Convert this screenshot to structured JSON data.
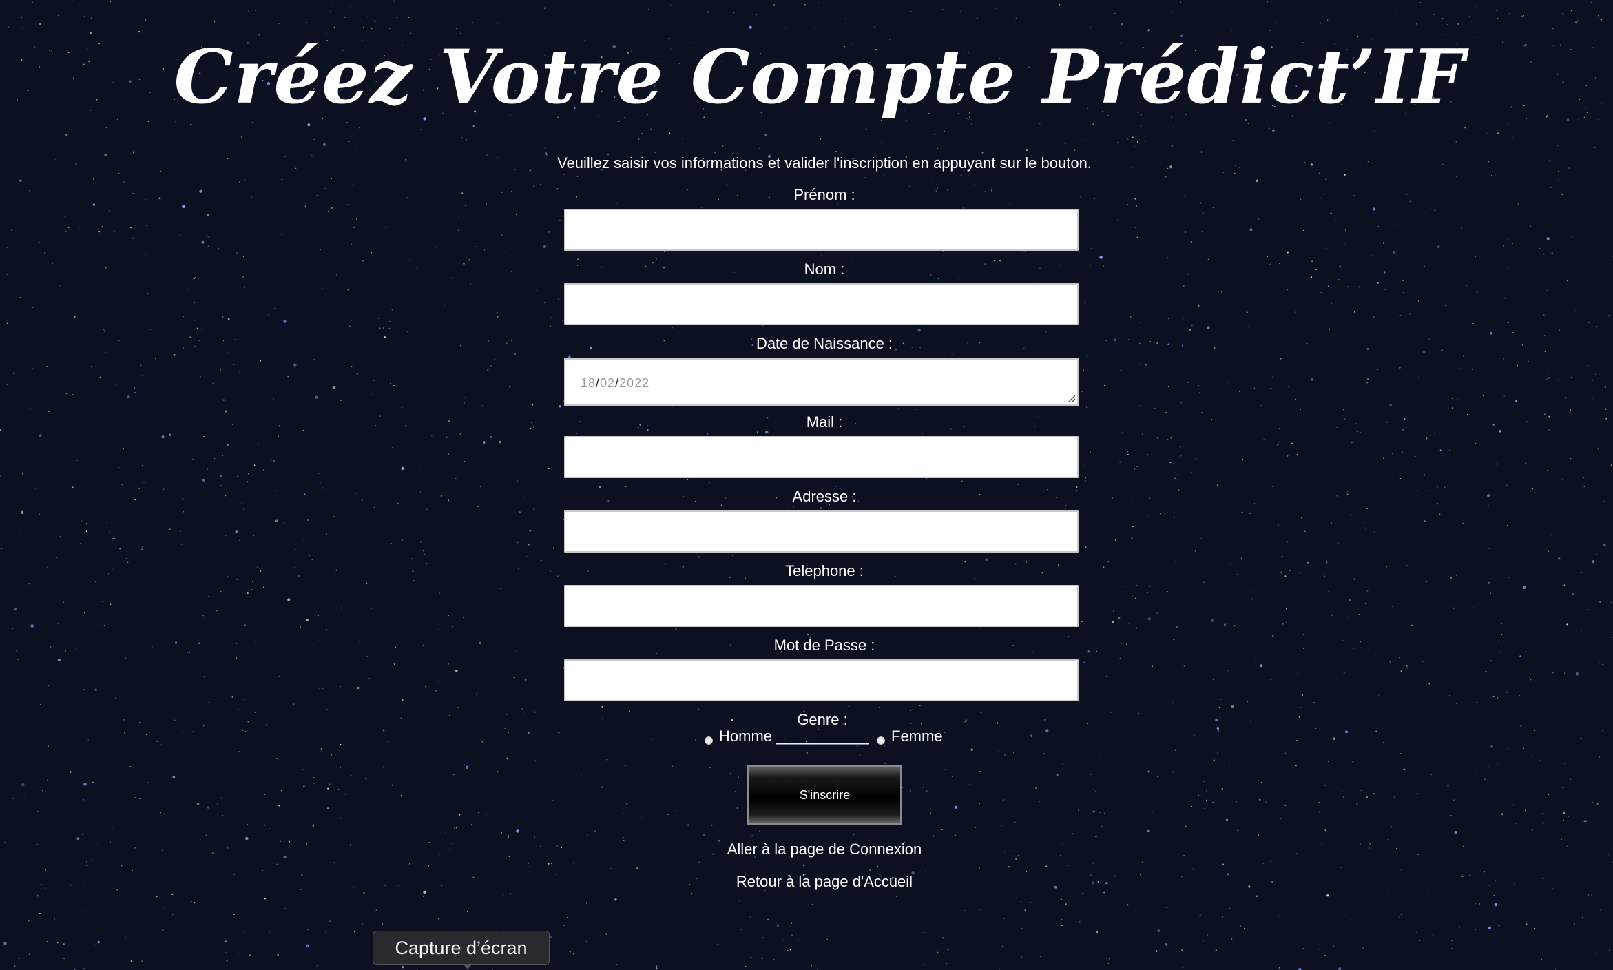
{
  "page": {
    "title": "Créez Votre Compte Prédict’IF",
    "intro": "Veuillez saisir vos informations et valider l'inscription en appuyant sur le bouton."
  },
  "form": {
    "prenom_label": "Prénom :",
    "nom_label": "Nom :",
    "naissance_label": "Date de Naissance :",
    "date": {
      "day": "18",
      "month": "02",
      "year": "2022",
      "separator": "/"
    },
    "mail_label": "Mail :",
    "adresse_label": "Adresse :",
    "telephone_label": "Telephone :",
    "password_label": "Mot de Passe :",
    "genre_label": "Genre :",
    "genre_options": {
      "homme": "Homme ___________",
      "femme": "Femme"
    },
    "submit_label": "S'inscrire"
  },
  "links": {
    "connexion": "Aller à la page de Connexion",
    "accueil": "Retour à la page d'Accueil"
  },
  "tooltip": {
    "text": "Capture d’écran"
  },
  "colors": {
    "background": "#0b1120",
    "star": "#8fa2ff",
    "text": "#ffffff"
  }
}
